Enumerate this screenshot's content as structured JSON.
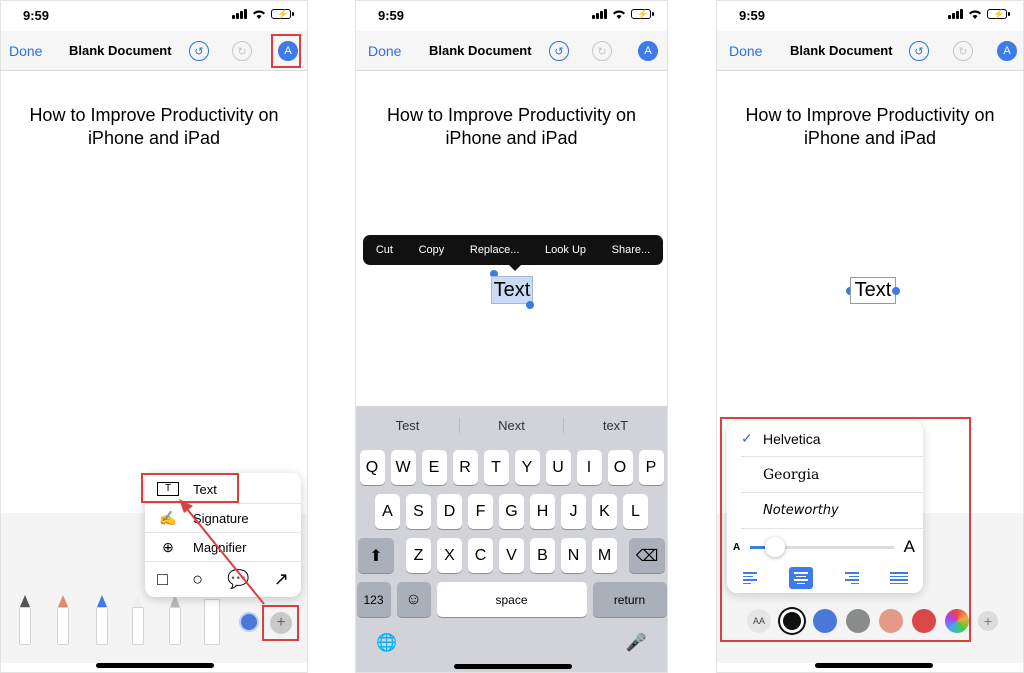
{
  "status": {
    "time": "9:59",
    "battery": "⚡"
  },
  "nav": {
    "done": "Done",
    "title": "Blank Document",
    "undo_glyph": "↺",
    "redo_glyph": "↻",
    "markup_glyph": "A"
  },
  "document": {
    "title_line1": "How to Improve Productivity on",
    "title_line2": "iPhone and iPad"
  },
  "add_menu": {
    "items": [
      {
        "label": "Text",
        "icon": "T"
      },
      {
        "label": "Signature",
        "icon": "✍"
      },
      {
        "label": "Magnifier",
        "icon": "⊕"
      }
    ],
    "shapes": [
      "□",
      "○",
      "💬",
      "↗"
    ],
    "plus": "+"
  },
  "edit_menu": [
    "Cut",
    "Copy",
    "Replace...",
    "Look Up",
    "Share..."
  ],
  "selected_text": "Text",
  "keyboard": {
    "predictions": [
      "Test",
      "Next",
      "texT"
    ],
    "row1": [
      "Q",
      "W",
      "E",
      "R",
      "T",
      "Y",
      "U",
      "I",
      "O",
      "P"
    ],
    "row2": [
      "A",
      "S",
      "D",
      "F",
      "G",
      "H",
      "J",
      "K",
      "L"
    ],
    "row3": [
      "Z",
      "X",
      "C",
      "V",
      "B",
      "N",
      "M"
    ],
    "shift": "⬆",
    "delete": "⌫",
    "numbers": "123",
    "emoji": "☺",
    "space": "space",
    "return": "return",
    "globe": "🌐",
    "mic": "🎤"
  },
  "font_panel": {
    "fonts": [
      "Helvetica",
      "Georgia",
      "Noteworthy"
    ],
    "selected": "Helvetica",
    "check": "✓",
    "small_a": "A",
    "large_a": "A",
    "size_level": 0.15
  },
  "color_row": {
    "aa": "AA",
    "colors": [
      "#111111",
      "#4a78d8",
      "#8a8c8a",
      "#e39a87",
      "#d94848"
    ],
    "plus": "+"
  }
}
